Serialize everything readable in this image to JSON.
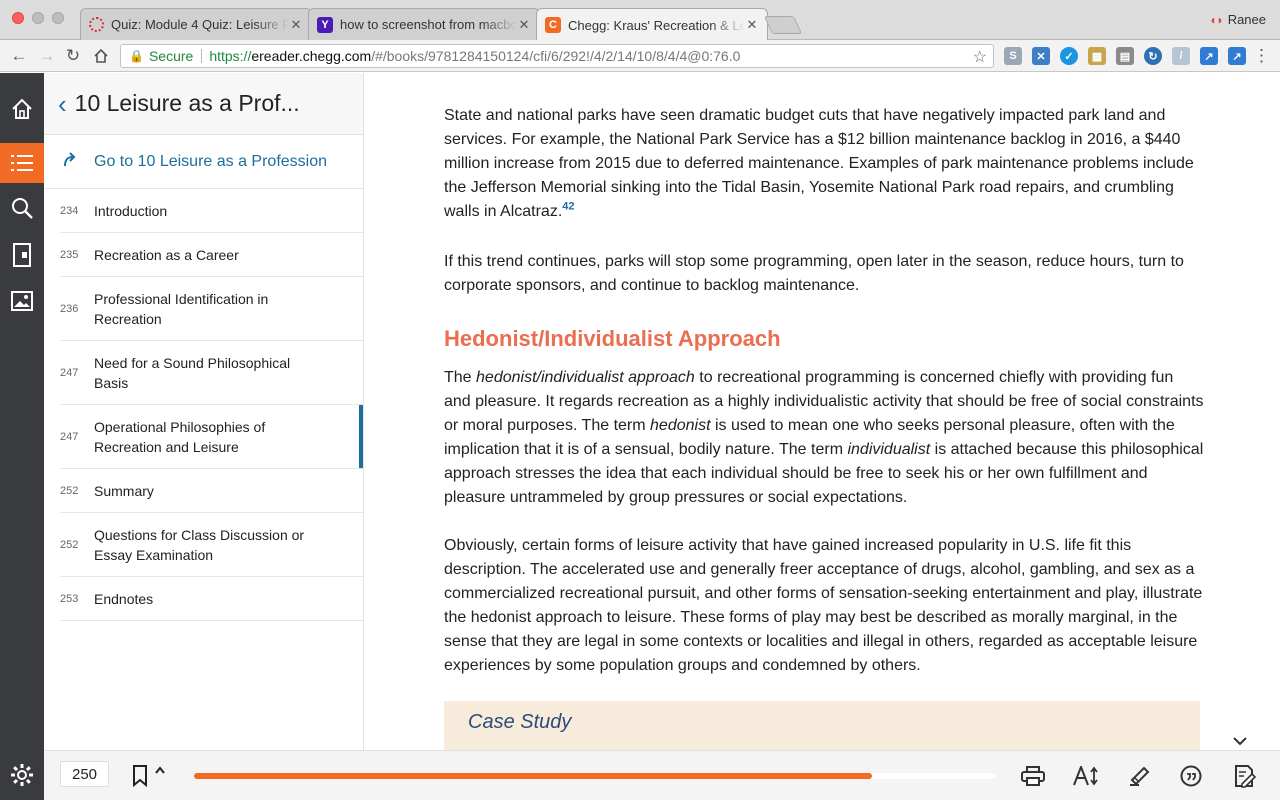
{
  "browser": {
    "tabs": [
      {
        "title": "Quiz: Module 4 Quiz: Leisure P",
        "favicon": "canvas-icon",
        "active": false
      },
      {
        "title": "how to screenshot from macbo",
        "favicon": "yahoo-icon",
        "active": false
      },
      {
        "title": "Chegg: Kraus' Recreation & Le",
        "favicon": "chegg-icon",
        "active": true
      }
    ],
    "profile_name": "Ranee",
    "address": {
      "secure_label": "Secure",
      "protocol": "https://",
      "host": "ereader.chegg.com",
      "path": "/#/books/9781284150124/cfi/6/292!/4/2/14/10/8/4/4@0:76.0"
    }
  },
  "toc": {
    "header_title": "10 Leisure as a Prof...",
    "goto_label": "Go to 10 Leisure as a Profession",
    "items": [
      {
        "page": "234",
        "label": "Introduction",
        "selected": false
      },
      {
        "page": "235",
        "label": "Recreation as a Career",
        "selected": false
      },
      {
        "page": "236",
        "label": "Professional Identification in Recreation",
        "selected": false
      },
      {
        "page": "247",
        "label": "Need for a Sound Philosophical Basis",
        "selected": false
      },
      {
        "page": "247",
        "label": "Operational Philosophies of Recreation and Leisure",
        "selected": true
      },
      {
        "page": "252",
        "label": "Summary",
        "selected": false
      },
      {
        "page": "252",
        "label": "Questions for Class Discussion or Essay Examination",
        "selected": false
      },
      {
        "page": "253",
        "label": "Endnotes",
        "selected": false
      }
    ]
  },
  "reader": {
    "para1": "State and national parks have seen dramatic budget cuts that have negatively impacted park land and services. For example, the National Park Service has a $12 billion maintenance backlog in 2016, a $440 million increase from 2015 due to deferred maintenance. Examples of park maintenance problems include the Jefferson Memorial sinking into the Tidal Basin, Yosemite National Park road repairs, and crumbling walls in Alcatraz.",
    "para1_cite": "42",
    "para2": "If this trend continues, parks will stop some programming, open later in the season, reduce hours, turn to corporate sponsors, and continue to backlog maintenance.",
    "heading": "Hedonist/Individualist Approach",
    "para3": {
      "t1": "The ",
      "i1": "hedonist/individualist approach",
      "t2": " to recreational programming is concerned chiefly with providing fun and pleasure. It regards recreation as a highly individualistic activity that should be free of social constraints or moral purposes. The term ",
      "i2": "hedonist",
      "t3": " is used to mean one who seeks personal pleasure, often with the implication that it is of a sensual, bodily nature. The term ",
      "i3": "individualist",
      "t4": " is attached because this philosophical approach stresses the idea that each individual should be free to seek his or her own fulfillment and pleasure untrammeled by group pressures or social expectations."
    },
    "para4": "Obviously, certain forms of leisure activity that have gained increased popularity in U.S. life fit this description. The accelerated use and generally freer acceptance of drugs, alcohol, gambling, and sex as a commercialized recreational pursuit, and other forms of sensation-seeking entertainment and play, illustrate the hedonist approach to leisure. These forms of play may best be described as morally marginal, in the sense that they are legal in some contexts or localities and illegal in others, regarded as acceptable leisure experiences by some population groups and condemned by others.",
    "case_study_title": "Case Study"
  },
  "bottom_bar": {
    "page_number": "250",
    "progress_percent": 84.5
  },
  "colors": {
    "accent": "#f26b25",
    "link": "#1a6f9b",
    "heading": "#ea6e4f",
    "rail": "#3a3b3f"
  }
}
